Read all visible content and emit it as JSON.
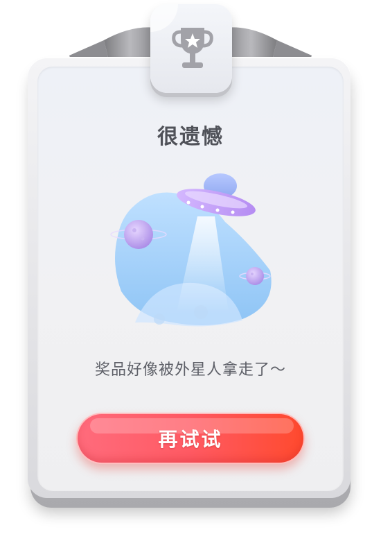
{
  "dialog": {
    "title": "很遗憾",
    "message": "奖品好像被外星人拿走了～",
    "retry_label": "再试试"
  },
  "icons": {
    "badge": "trophy-icon",
    "illustration": "ufo-planet-illustration"
  },
  "colors": {
    "button_start": "#ff6b7c",
    "button_end": "#ff4a2e",
    "title": "#505259",
    "message": "#5e6068"
  }
}
